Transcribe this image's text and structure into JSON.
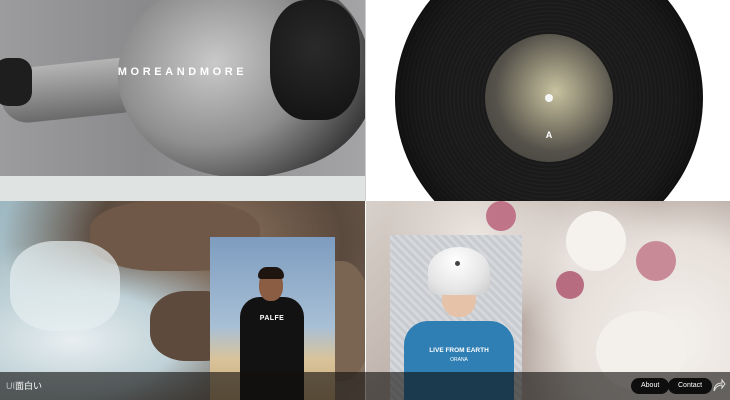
{
  "tiles": {
    "fashion": {
      "brand": "MOREANDMORE"
    },
    "record": {
      "side_letter": "A"
    },
    "portrait": {
      "hoodie_print": "PALFE"
    },
    "helmet": {
      "shirt_line1": "LIVE FROM EARTH",
      "shirt_line2": "ORANA"
    }
  },
  "footer": {
    "logo_prefix": "UI",
    "logo_text": "面白い",
    "nav": [
      {
        "label": "About"
      },
      {
        "label": "Contact"
      }
    ],
    "share_icon": "share-arrow-icon"
  },
  "colors": {
    "bar_bg": "#12100e",
    "button_bg": "#0e0e0e",
    "stripe": "#dfe3e1"
  }
}
